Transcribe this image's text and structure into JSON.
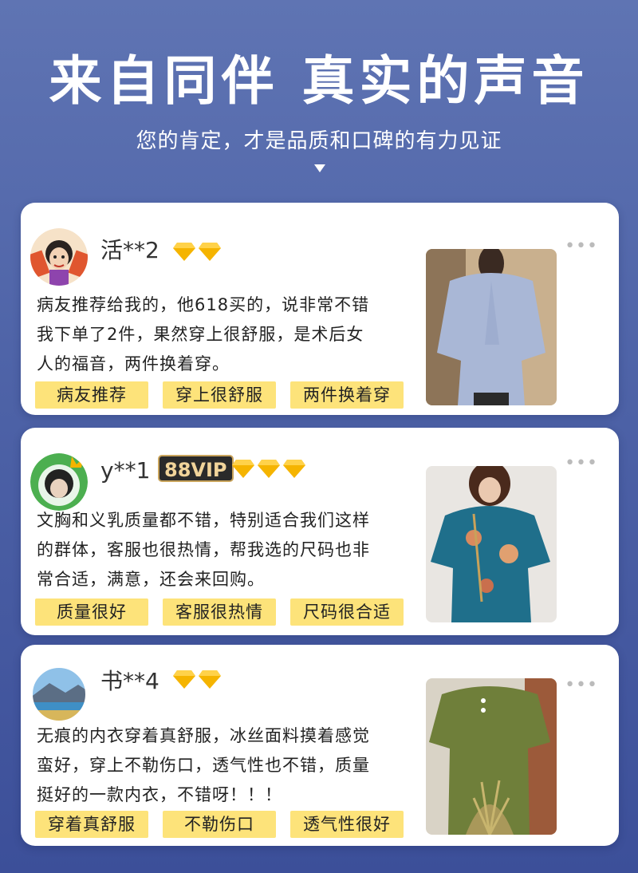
{
  "header": {
    "title": "来自同伴 真实的声音",
    "subtitle": "您的肯定，才是品质和口碑的有力见证"
  },
  "reviews": [
    {
      "username": "活**2",
      "vip": "",
      "diamonds": 2,
      "text_lines": [
        "病友推荐给我的，他618买的，说非常不错",
        "我下单了2件，果然穿上很舒服，是术后女",
        "人的福音，两件换着穿。"
      ],
      "tags": [
        "病友推荐",
        "穿上很舒服",
        "两件换着穿"
      ],
      "more": "•••"
    },
    {
      "username": "y**1",
      "vip": "88VIP",
      "diamonds": 3,
      "text_lines": [
        "文胸和义乳质量都不错，特别适合我们这样",
        "的群体，客服也很热情，帮我选的尺码也非",
        "常合适，满意，还会来回购。"
      ],
      "tags": [
        "质量很好",
        "客服很热情",
        "尺码很合适"
      ],
      "more": "•••"
    },
    {
      "username": "书**4",
      "vip": "",
      "diamonds": 2,
      "text_lines": [
        "无痕的内衣穿着真舒服，冰丝面料摸着感觉",
        "蛮好，穿上不勒伤口，透气性也不错，质量",
        "挺好的一款内衣，不错呀！！！"
      ],
      "tags": [
        "穿着真舒服",
        "不勒伤口",
        "透气性很好"
      ],
      "more": "•••"
    }
  ],
  "colors": {
    "tag_bg": "#fde37a",
    "diamond": "#f5b400",
    "vip_bg": "#2a2a2a"
  }
}
